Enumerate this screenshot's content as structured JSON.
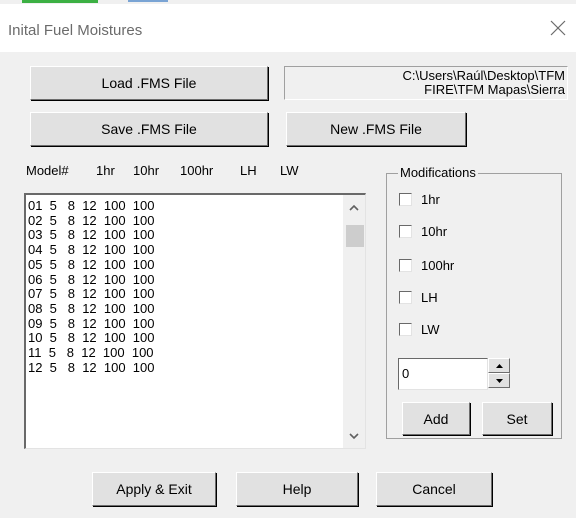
{
  "window": {
    "title": "Inital Fuel Moistures"
  },
  "buttons": {
    "load": "Load .FMS File",
    "save": "Save .FMS File",
    "new": "New .FMS File",
    "apply": "Apply & Exit",
    "help": "Help",
    "cancel": "Cancel",
    "add": "Add",
    "set": "Set"
  },
  "path": {
    "line1": "C:\\Users\\Raúl\\Desktop\\TFM",
    "line2": "FIRE\\TFM Mapas\\Sierra"
  },
  "columns": [
    "Model#",
    "1hr",
    "10hr",
    "100hr",
    "LH",
    "LW"
  ],
  "rows": [
    "01  5   8  12  100  100",
    "02  5   8  12  100  100",
    "03  5   8  12  100  100",
    "04  5   8  12  100  100",
    "05  5   8  12  100  100",
    "06  5   8  12  100  100",
    "07  5   8  12  100  100",
    "08  5   8  12  100  100",
    "09  5   8  12  100  100",
    "10  5   8  12  100  100",
    "11  5   8  12  100  100",
    "12  5   8  12  100  100"
  ],
  "modifications": {
    "label": "Modifications",
    "options": [
      {
        "label": "1hr",
        "checked": false
      },
      {
        "label": "10hr",
        "checked": false
      },
      {
        "label": "100hr",
        "checked": false
      },
      {
        "label": "LH",
        "checked": false
      },
      {
        "label": "LW",
        "checked": false
      }
    ],
    "value": "0"
  },
  "icons": {
    "close": "close-icon",
    "scroll_up": "chevron-up-icon",
    "scroll_down": "chevron-down-icon",
    "spin_up": "arrow-up-icon",
    "spin_down": "arrow-down-icon"
  }
}
